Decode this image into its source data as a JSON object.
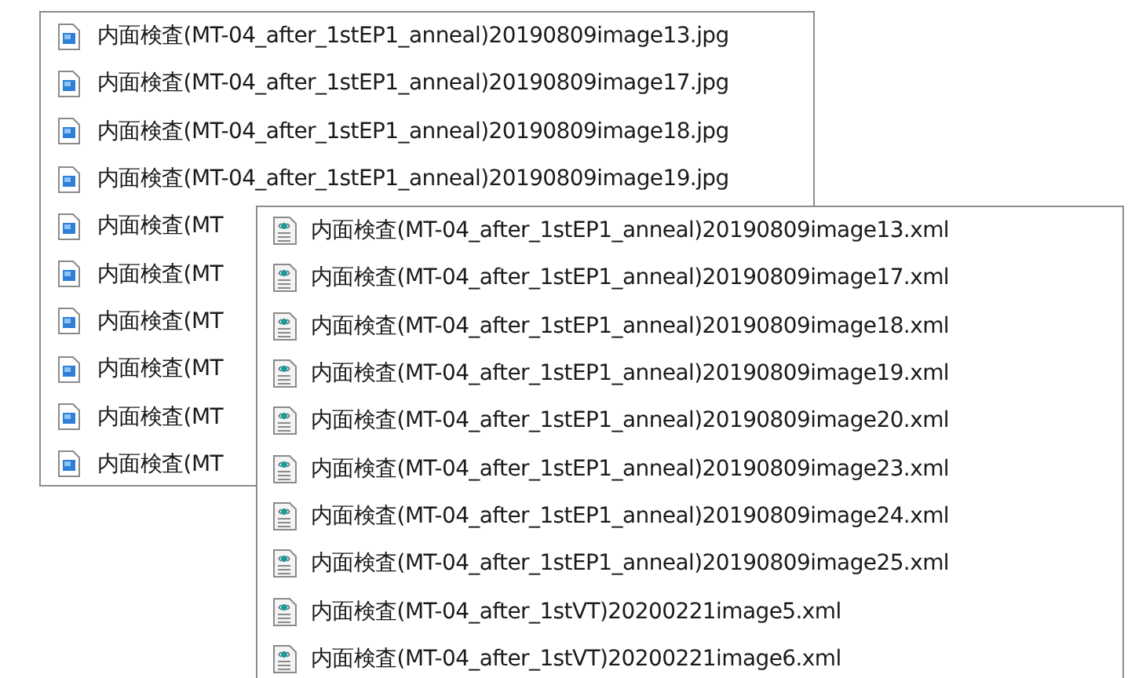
{
  "lists": [
    {
      "kind": "image",
      "files": [
        "内面検査(MT-04_after_1stEP1_anneal)20190809image13.jpg",
        "内面検査(MT-04_after_1stEP1_anneal)20190809image17.jpg",
        "内面検査(MT-04_after_1stEP1_anneal)20190809image18.jpg",
        "内面検査(MT-04_after_1stEP1_anneal)20190809image19.jpg",
        "内面検査(MT",
        "内面検査(MT",
        "内面検査(MT",
        "内面検査(MT",
        "内面検査(MT",
        "内面検査(MT"
      ]
    },
    {
      "kind": "xml",
      "files": [
        "内面検査(MT-04_after_1stEP1_anneal)20190809image13.xml",
        "内面検査(MT-04_after_1stEP1_anneal)20190809image17.xml",
        "内面検査(MT-04_after_1stEP1_anneal)20190809image18.xml",
        "内面検査(MT-04_after_1stEP1_anneal)20190809image19.xml",
        "内面検査(MT-04_after_1stEP1_anneal)20190809image20.xml",
        "内面検査(MT-04_after_1stEP1_anneal)20190809image23.xml",
        "内面検査(MT-04_after_1stEP1_anneal)20190809image24.xml",
        "内面検査(MT-04_after_1stEP1_anneal)20190809image25.xml",
        "内面検査(MT-04_after_1stVT)20200221image5.xml",
        "内面検査(MT-04_after_1stVT)20200221image6.xml"
      ]
    }
  ]
}
